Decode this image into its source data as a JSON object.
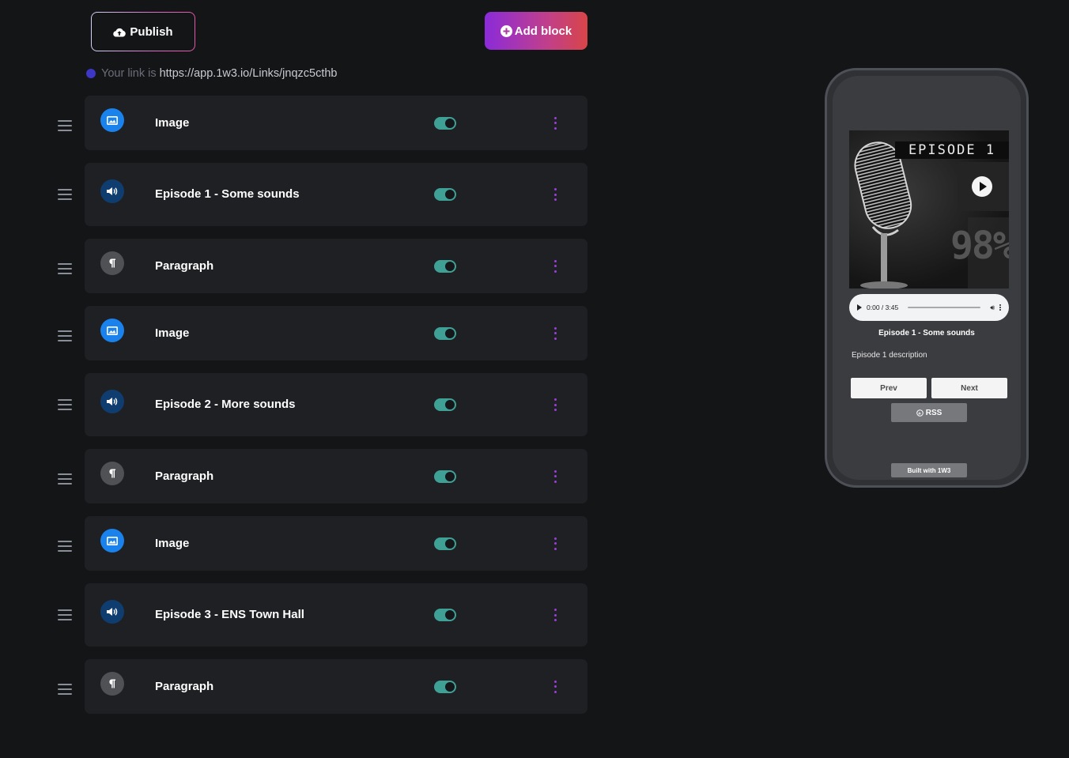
{
  "toolbar": {
    "publish_label": "Publish",
    "add_block_label": "Add block"
  },
  "link": {
    "label": "Your link is",
    "url": "https://app.1w3.io/Links/jnqzc5cthb"
  },
  "blocks": [
    {
      "type": "image",
      "icon": "image-icon",
      "title": "Image",
      "enabled": true
    },
    {
      "type": "audio",
      "icon": "speaker-icon",
      "title": "Episode 1 - Some sounds",
      "enabled": true
    },
    {
      "type": "paragraph",
      "icon": "pilcrow-icon",
      "title": "Paragraph",
      "enabled": true
    },
    {
      "type": "image",
      "icon": "image-icon",
      "title": "Image",
      "enabled": true
    },
    {
      "type": "audio",
      "icon": "speaker-icon",
      "title": "Episode 2 - More sounds",
      "enabled": true
    },
    {
      "type": "paragraph",
      "icon": "pilcrow-icon",
      "title": "Paragraph",
      "enabled": true
    },
    {
      "type": "image",
      "icon": "image-icon",
      "title": "Image",
      "enabled": true
    },
    {
      "type": "audio",
      "icon": "speaker-icon",
      "title": "Episode 3 - ENS Town Hall",
      "enabled": true
    },
    {
      "type": "paragraph",
      "icon": "pilcrow-icon",
      "title": "Paragraph",
      "enabled": true
    }
  ],
  "colors": {
    "accent_purple": "#9d3dde",
    "toggle_on": "#3fa196",
    "image_icon_bg": "#1a82ec",
    "audio_icon_bg": "#103d6f"
  },
  "preview": {
    "cover_banner": "EPISODE 1",
    "cover_text": "98%",
    "player_time": "0:00 / 3:45",
    "episode_title": "Episode 1 - Some sounds",
    "episode_description": "Episode 1 description",
    "prev_label": "Prev",
    "next_label": "Next",
    "rss_label": "RSS",
    "built_with": "Built with 1W3"
  }
}
